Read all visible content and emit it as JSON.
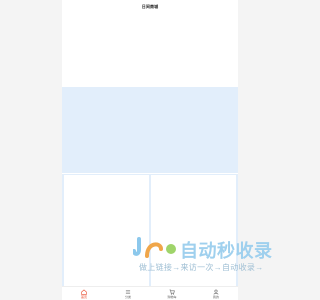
{
  "header": {
    "title": "日间商城"
  },
  "tabbar": {
    "items": [
      {
        "label": "首页",
        "icon": "home-icon",
        "active": true
      },
      {
        "label": "分类",
        "icon": "category-icon",
        "active": false
      },
      {
        "label": "购物车",
        "icon": "cart-icon",
        "active": false
      },
      {
        "label": "我的",
        "icon": "user-icon",
        "active": false
      }
    ]
  },
  "watermark": {
    "name": "自动秒收录",
    "tagline": "做上链接→来访一次→自动收录→"
  },
  "colors": {
    "accent": "#e8492b",
    "banner": "#e2eefb",
    "watermark": "#9fd0ee"
  }
}
